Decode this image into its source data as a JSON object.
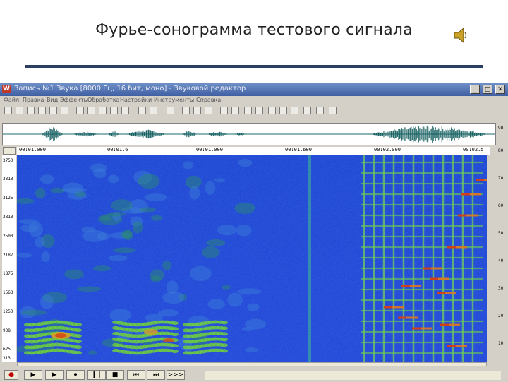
{
  "slide": {
    "title": "Фурье-сонограмма тестового сигнала"
  },
  "window": {
    "title": "Запись №1 Звука [8000 Гц, 16 бит, моно] - Звуковой редактор",
    "controls": [
      "_",
      "□",
      "✕"
    ]
  },
  "menu": [
    "Файл",
    "Правка",
    "Вид",
    "Эффекты",
    "Обработка",
    "Настройки",
    "Инструменты",
    "Справка"
  ],
  "ruler": {
    "time_labels": [
      "00:01.000",
      "00:01.6",
      "00:01.000",
      "00:01.600",
      "00:02.000",
      "00:02.5"
    ]
  },
  "freq_axis": {
    "labels": [
      "3750",
      "3313",
      "3125",
      "2813",
      "2500",
      "2187",
      "1875",
      "1563",
      "1250",
      "938",
      "625",
      "313"
    ]
  },
  "db_axis": {
    "labels": [
      "90",
      "80",
      "70",
      "60",
      "50",
      "40",
      "30",
      "20",
      "10"
    ]
  },
  "transport": {
    "buttons": [
      "●",
      "▶",
      "▶",
      "⏺",
      "❙❙",
      "■",
      "⏮",
      "⏭",
      ">>>"
    ]
  }
}
